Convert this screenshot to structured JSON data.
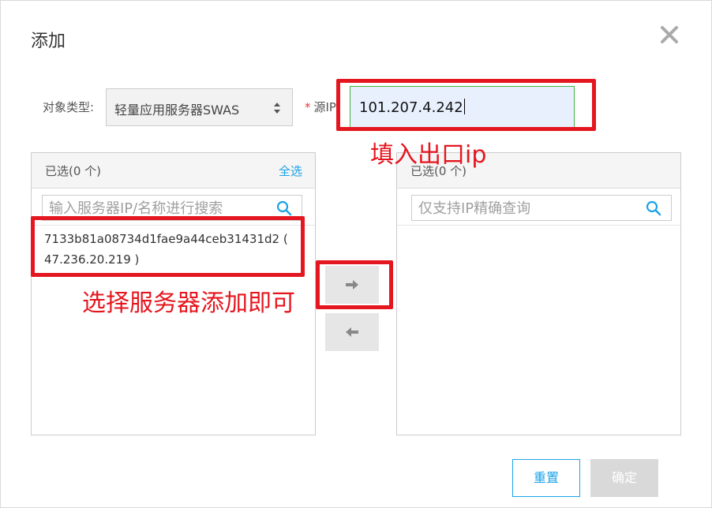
{
  "dialog": {
    "title": "添加",
    "close_icon": "close-icon"
  },
  "form": {
    "type_label": "对象类型:",
    "type_value": "轻量应用服务器SWAS",
    "ip_required_mark": "*",
    "ip_label": "源IP:",
    "ip_value": "101.207.4.242"
  },
  "left_panel": {
    "count": "已选(0 个)",
    "select_all": "全选",
    "search_placeholder": "输入服务器IP/名称进行搜索",
    "items": [
      {
        "line1": "7133b81a08734d1fae9a44ceb31431d2 (",
        "line2": "47.236.20.219 )"
      }
    ]
  },
  "right_panel": {
    "count": "已选(0 个)",
    "search_placeholder": "仅支持IP精确查询"
  },
  "transfer": {
    "right_icon": "arrow-right-icon",
    "left_icon": "arrow-left-icon"
  },
  "footer": {
    "reset_label": "重置",
    "ok_label": "确定"
  },
  "annotations": {
    "fill_ip": "填入出口ip",
    "select_server": "选择服务器添加即可"
  },
  "colors": {
    "accent": "#1aa3e8",
    "annotation_red": "#e4161f",
    "input_focus_border": "#44b144"
  }
}
